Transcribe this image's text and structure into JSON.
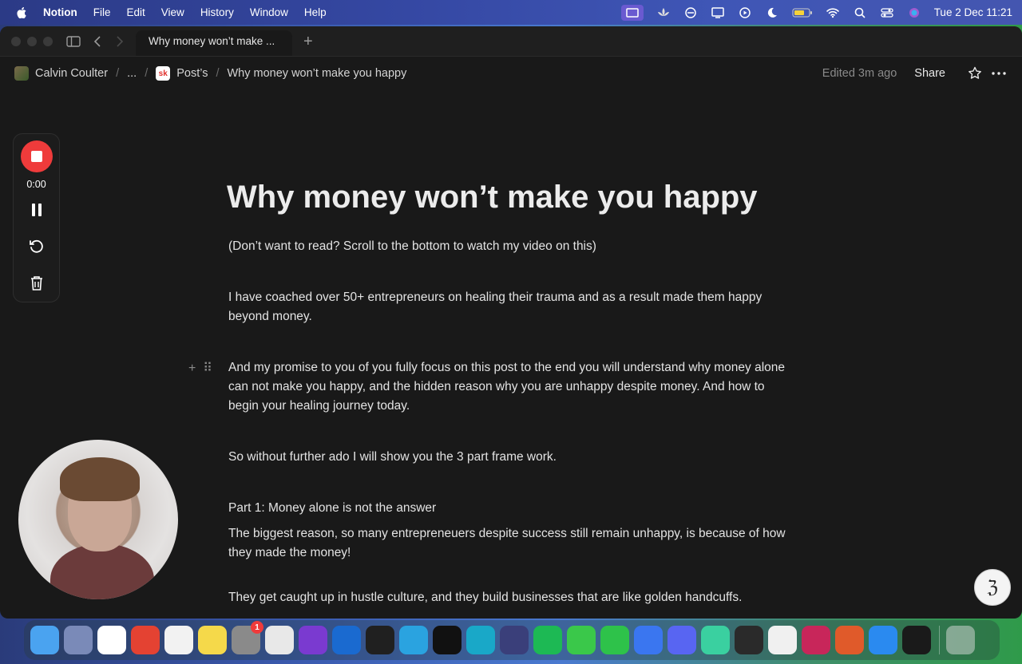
{
  "menubar": {
    "app_name": "Notion",
    "menus": [
      "File",
      "Edit",
      "View",
      "History",
      "Window",
      "Help"
    ],
    "clock": "Tue 2 Dec  11:21"
  },
  "tab": {
    "title": "Why money won’t make ..."
  },
  "breadcrumb": {
    "workspace": "Calvin Coulter",
    "ellipsis": "...",
    "parent_icon_text": "sk",
    "parent": "Post’s",
    "current": "Why money won’t make you happy"
  },
  "topbar": {
    "edited": "Edited 3m ago",
    "share": "Share"
  },
  "recorder": {
    "timer": "0:00"
  },
  "page": {
    "title": "Why money won’t make you happy",
    "blocks": [
      "(Don’t want to read? Scroll to the bottom to watch my video on this)",
      "I have coached over 50+ entrepreneurs on healing their trauma and as a result made them happy beyond money.",
      "And my promise to you of you fully focus on this post to the end you will understand why money alone can not make you happy, and the hidden reason why you are unhappy despite money. And how to begin your healing journey today.",
      "So without further ado I will show you the 3 part frame work.",
      "Part 1: Money alone is not the answer",
      "The biggest reason, so many entrepreneuers despite success still remain unhappy, is because of how they made the money!",
      "They get caught up in hustle culture, and they build businesses that are like golden handcuffs."
    ]
  },
  "dock": {
    "apps": [
      {
        "name": "finder",
        "color": "#4aa3f0"
      },
      {
        "name": "launchpad",
        "color": "#7a8ab8"
      },
      {
        "name": "notion",
        "color": "#ffffff"
      },
      {
        "name": "todoist",
        "color": "#e44232"
      },
      {
        "name": "reminders",
        "color": "#f2f2f2"
      },
      {
        "name": "notes",
        "color": "#f5d94a"
      },
      {
        "name": "system-settings",
        "color": "#8a8a8a",
        "badge": "1"
      },
      {
        "name": "chrome",
        "color": "#e8e8e8"
      },
      {
        "name": "arc",
        "color": "#7a3ad0"
      },
      {
        "name": "setapp",
        "color": "#1a6ad0"
      },
      {
        "name": "audio-app",
        "color": "#202020"
      },
      {
        "name": "telegram",
        "color": "#2aa3e0"
      },
      {
        "name": "capcut",
        "color": "#111111"
      },
      {
        "name": "canva",
        "color": "#19a8c8"
      },
      {
        "name": "proton-vpn",
        "color": "#3a3f7a"
      },
      {
        "name": "spotify",
        "color": "#1db954"
      },
      {
        "name": "messages",
        "color": "#3ac84a"
      },
      {
        "name": "whatsapp",
        "color": "#2ec24a"
      },
      {
        "name": "signal",
        "color": "#3a76f0"
      },
      {
        "name": "discord",
        "color": "#5865f2"
      },
      {
        "name": "sheet-app",
        "color": "#3ad0a0"
      },
      {
        "name": "github-app",
        "color": "#2a2a2a"
      },
      {
        "name": "photos",
        "color": "#f0f0f0"
      },
      {
        "name": "red-app",
        "color": "#c8265a"
      },
      {
        "name": "pencil-app",
        "color": "#e05a2a"
      },
      {
        "name": "app-store",
        "color": "#2a8af0"
      },
      {
        "name": "flow-app",
        "color": "#1a1a1a"
      }
    ]
  }
}
